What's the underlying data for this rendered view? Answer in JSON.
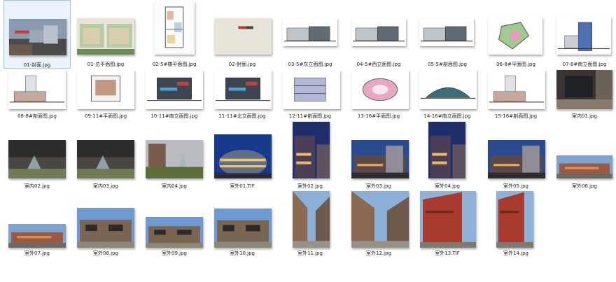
{
  "files": [
    {
      "name": "01-封面.jpg",
      "kind": "photo-cover",
      "selected": true
    },
    {
      "name": "01-总平面图.jpg",
      "kind": "siteplan"
    },
    {
      "name": "02-5#楼平面图.jpg",
      "kind": "floorplan-tall"
    },
    {
      "name": "02-封面.jpg",
      "kind": "cover-beige"
    },
    {
      "name": "03-5#东立面图.jpg",
      "kind": "elevation"
    },
    {
      "name": "04-5#西立面图.jpg",
      "kind": "elevation"
    },
    {
      "name": "05-5#剖面图.jpg",
      "kind": "elevation"
    },
    {
      "name": "06-8#平面图.jpg",
      "kind": "floorplan-color"
    },
    {
      "name": "07-8#南立面图.jpg",
      "kind": "elevation-tower"
    },
    {
      "name": "08-8#剖面图.jpg",
      "kind": "section"
    },
    {
      "name": "09-11#平面图.jpg",
      "kind": "floorplan"
    },
    {
      "name": "10-11#南立面图.jpg",
      "kind": "elevation-dark"
    },
    {
      "name": "11-11#北立面图.jpg",
      "kind": "elevation-dark"
    },
    {
      "name": "12-11#剖面图.jpg",
      "kind": "section-blue"
    },
    {
      "name": "13-16#平面图.jpg",
      "kind": "floorplan-pink"
    },
    {
      "name": "14-16#南立面图.jpg",
      "kind": "elevation-round"
    },
    {
      "name": "15-16#剖面图.jpg",
      "kind": "section"
    },
    {
      "name": "室内01.jpg",
      "kind": "photo-dark"
    },
    {
      "name": "室内02.jpg",
      "kind": "photo-court"
    },
    {
      "name": "室内03.jpg",
      "kind": "photo-court"
    },
    {
      "name": "室内04.jpg",
      "kind": "photo-garden"
    },
    {
      "name": "室外01.TIF",
      "kind": "photo-night"
    },
    {
      "name": "室外02.jpg",
      "kind": "photo-night-tall"
    },
    {
      "name": "室外03.jpg",
      "kind": "photo-dusk"
    },
    {
      "name": "室外04.jpg",
      "kind": "photo-night-tall"
    },
    {
      "name": "室外05.jpg",
      "kind": "photo-dusk"
    },
    {
      "name": "室外06.jpg",
      "kind": "photo-wide"
    },
    {
      "name": "室外07.jpg",
      "kind": "photo-wide"
    },
    {
      "name": "室外08.jpg",
      "kind": "photo-day"
    },
    {
      "name": "室外09.jpg",
      "kind": "photo-day"
    },
    {
      "name": "室外10.jpg",
      "kind": "photo-day"
    },
    {
      "name": "室外11.jpg",
      "kind": "photo-alley"
    },
    {
      "name": "室外12.jpg",
      "kind": "photo-alley"
    },
    {
      "name": "室外13.TIF",
      "kind": "photo-red"
    },
    {
      "name": "室外14.jpg",
      "kind": "photo-red"
    }
  ]
}
